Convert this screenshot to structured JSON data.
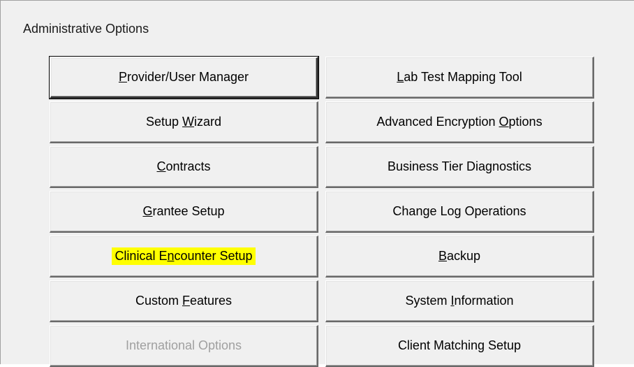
{
  "window": {
    "group_title": "Administrative Options"
  },
  "buttons_left": [
    {
      "pre": "",
      "key": "P",
      "post": "rovider/User Manager",
      "enabled": true,
      "highlighted": false
    },
    {
      "pre": "Setup ",
      "key": "W",
      "post": "izard",
      "enabled": true,
      "highlighted": false
    },
    {
      "pre": "",
      "key": "C",
      "post": "ontracts",
      "enabled": true,
      "highlighted": false
    },
    {
      "pre": "",
      "key": "G",
      "post": "rantee Setup",
      "enabled": true,
      "highlighted": false
    },
    {
      "pre": "Clinical E",
      "key": "n",
      "post": "counter Setup",
      "enabled": true,
      "highlighted": true
    },
    {
      "pre": "Custom ",
      "key": "F",
      "post": "eatures",
      "enabled": true,
      "highlighted": false
    },
    {
      "pre": "International Options",
      "key": "",
      "post": "",
      "enabled": false,
      "highlighted": false
    }
  ],
  "buttons_right": [
    {
      "pre": "",
      "key": "L",
      "post": "ab Test Mapping Tool",
      "enabled": true,
      "highlighted": false
    },
    {
      "pre": "Advanced Encryption ",
      "key": "O",
      "post": "ptions",
      "enabled": true,
      "highlighted": false
    },
    {
      "pre": "Business Tier Diagnostics",
      "key": "",
      "post": "",
      "enabled": true,
      "highlighted": false
    },
    {
      "pre": "Change Log Operations",
      "key": "",
      "post": "",
      "enabled": true,
      "highlighted": false
    },
    {
      "pre": "",
      "key": "B",
      "post": "ackup",
      "enabled": true,
      "highlighted": false
    },
    {
      "pre": "System ",
      "key": "I",
      "post": "nformation",
      "enabled": true,
      "highlighted": false
    },
    {
      "pre": "Client Matching Setup",
      "key": "",
      "post": "",
      "enabled": true,
      "highlighted": false
    }
  ],
  "colors": {
    "highlight": "#ffff00",
    "disabled_text": "#a0a0a0",
    "face": "#f0f0f0"
  }
}
